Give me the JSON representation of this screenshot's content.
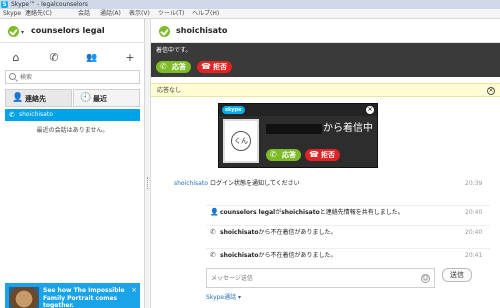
{
  "window": {
    "title": "Skype™ - legalcounselors"
  },
  "menu": [
    "Skype",
    "連絡先(C)",
    "会話",
    "通話(A)",
    "表示(V)",
    "ツール(T)",
    "ヘルプ(H)"
  ],
  "account": {
    "name": "counselors legal"
  },
  "search": {
    "placeholder": "検索"
  },
  "tabs": {
    "contacts": "連絡先",
    "recent": "最近"
  },
  "contacts": [
    {
      "name": "shoichisato"
    }
  ],
  "empty_text": "最近の会話はありません。",
  "promo": {
    "text": "See how The Impossible Family Portrait comes together.",
    "close": "×"
  },
  "conversation": {
    "contact_name": "shoichisato",
    "callbar_text": "着信中です。",
    "answer_label": "応答",
    "decline_label": "拒否",
    "no_answer_label": "応答なし",
    "close_glyph": "×"
  },
  "popup": {
    "brand": "skype",
    "incoming_text": "から着信中",
    "avatar_text": "くん",
    "answer_label": "応答",
    "decline_label": "拒否",
    "close_glyph": "×"
  },
  "chat": {
    "sender": "shoichisato",
    "messages": [
      {
        "text": "ログイン状態を通知してください",
        "time": "20:39"
      },
      {
        "bold": "counselors legal",
        "mid": "が",
        "bold2": "shoichisato",
        "text": "と連絡先情報を共有しました。",
        "time": "20:40"
      },
      {
        "bold": "shoichisato",
        "text": "から不在着信がありました。",
        "time": "20:40"
      },
      {
        "bold": "shoichisato",
        "text": "から不在着信がありました。",
        "time": "20:41"
      }
    ]
  },
  "composer": {
    "placeholder": "メッセージ送信",
    "send_label": "送信",
    "skype_wifi": "Skype通話 ▾"
  },
  "icons": {
    "home": "⌂",
    "call": "✆",
    "group": "👥",
    "add_contact": "+",
    "contacts_tab": "👤",
    "recent_tab": "🕘",
    "contact_status": "✆",
    "chat_user": "👤",
    "chat_phone": "✆",
    "emoji": "☺"
  },
  "colors": {
    "accent": "#00a2e8",
    "online": "#7dbb27",
    "decline": "#e02323",
    "callbar": "#3a3a3a"
  }
}
